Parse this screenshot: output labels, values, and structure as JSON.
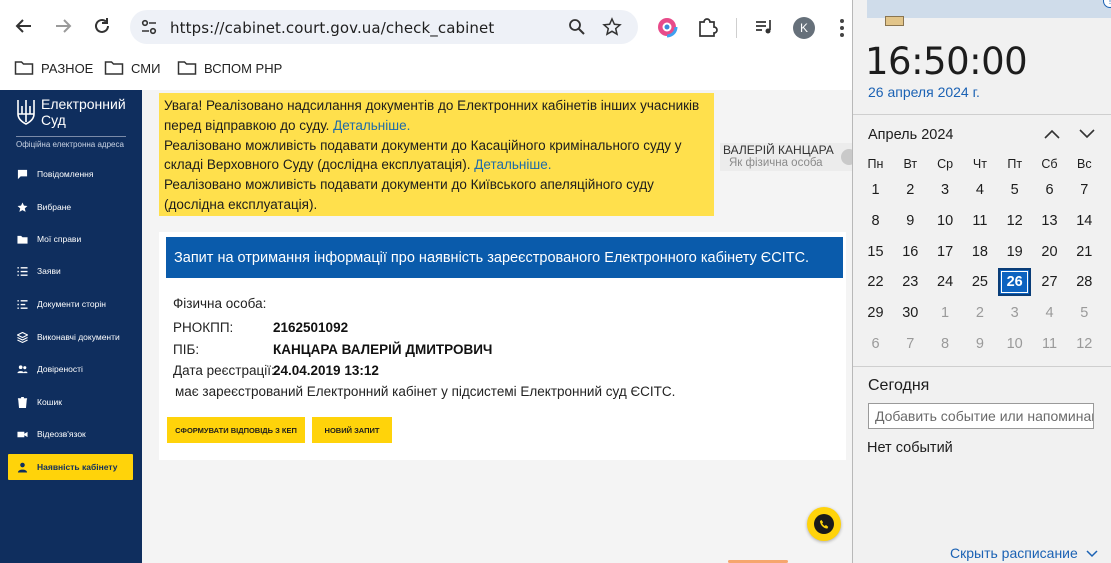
{
  "browser": {
    "url": "https://cabinet.court.gov.ua/check_cabinet",
    "avatar_letter": "K",
    "bookmarks": [
      "РАЗНОЕ",
      "СМИ",
      "ВСПОМ PHP"
    ]
  },
  "site": {
    "logo_line1": "Електронний",
    "logo_line2": "Суд",
    "logo_sub": "Офіційна електронна адреса",
    "accent_color": "#ffd30a",
    "brand_color": "#0f2e5e"
  },
  "sidebar": {
    "items": [
      {
        "label": "Повідомлення",
        "icon": "message-icon",
        "active": false
      },
      {
        "label": "Вибране",
        "icon": "star-icon",
        "active": false
      },
      {
        "label": "Мої справи",
        "icon": "folder-icon",
        "active": false
      },
      {
        "label": "Заяви",
        "icon": "list-icon",
        "active": false
      },
      {
        "label": "Документи сторін",
        "icon": "list-numbered-icon",
        "active": false
      },
      {
        "label": "Виконавчі документи",
        "icon": "layers-icon",
        "active": false
      },
      {
        "label": "Довіреності",
        "icon": "users-icon",
        "active": false
      },
      {
        "label": "Кошик",
        "icon": "trash-icon",
        "active": false
      },
      {
        "label": "Відеозв'язок",
        "icon": "video-icon",
        "active": false
      },
      {
        "label": "Наявність кабінету",
        "icon": "person-icon",
        "active": true
      }
    ]
  },
  "notice": {
    "p1": "Увага! Реалізовано надсилання документів до Електронних кабінетів інших учасників перед відправкою до суду.",
    "p1_link": "Детальніше.",
    "p2": "Реалізовано можливість подавати документи до Касаційного кримінального суду у складі Верховного Суду (дослідна експлуатація).",
    "p2_link": "Детальніше.",
    "p3": "Реалізовано можливість подавати документи до Київського апеляційного суду (дослідна експлуатація)."
  },
  "user": {
    "name": "ВАЛЕРІЙ КАНЦАРА",
    "role": "Як фізична особа"
  },
  "card": {
    "title": "Запит на отримання інформації про наявність зареєстрованого Електронного кабінету ЄСІТС.",
    "person_type": "Фізична особа:",
    "rnokpp_label": "РНОКПП:",
    "rnokpp": "2162501092",
    "pib_label": "ПІБ:",
    "pib": "КАНЦАРА ВАЛЕРІЙ ДМИТРОВИЧ",
    "reg_label": "Дата реєстрації:",
    "reg_date": "24.04.2019 13:12",
    "note": "має зареєстрований Електронний кабінет у підсистемі Електронний суд ЄСІТС.",
    "btn_form": "СФОРМУВАТИ ВІДПОВІДЬ З КЕП",
    "btn_new": "НОВИЙ ЗАПИТ"
  },
  "calendar": {
    "time": "16:50:00",
    "date": "26 апреля 2024 г.",
    "month": "Апрель 2024",
    "weekdays": [
      "Пн",
      "Вт",
      "Ср",
      "Чт",
      "Пт",
      "Сб",
      "Вс"
    ],
    "weeks": [
      [
        {
          "d": "1"
        },
        {
          "d": "2"
        },
        {
          "d": "3"
        },
        {
          "d": "4"
        },
        {
          "d": "5"
        },
        {
          "d": "6"
        },
        {
          "d": "7"
        }
      ],
      [
        {
          "d": "8"
        },
        {
          "d": "9"
        },
        {
          "d": "10"
        },
        {
          "d": "11"
        },
        {
          "d": "12"
        },
        {
          "d": "13"
        },
        {
          "d": "14"
        }
      ],
      [
        {
          "d": "15"
        },
        {
          "d": "16"
        },
        {
          "d": "17"
        },
        {
          "d": "18"
        },
        {
          "d": "19"
        },
        {
          "d": "20"
        },
        {
          "d": "21"
        }
      ],
      [
        {
          "d": "22"
        },
        {
          "d": "23"
        },
        {
          "d": "24"
        },
        {
          "d": "25"
        },
        {
          "d": "26",
          "today": true
        },
        {
          "d": "27"
        },
        {
          "d": "28"
        }
      ],
      [
        {
          "d": "29"
        },
        {
          "d": "30"
        },
        {
          "d": "1",
          "dim": true
        },
        {
          "d": "2",
          "dim": true
        },
        {
          "d": "3",
          "dim": true
        },
        {
          "d": "4",
          "dim": true
        },
        {
          "d": "5",
          "dim": true
        }
      ],
      [
        {
          "d": "6",
          "dim": true
        },
        {
          "d": "7",
          "dim": true
        },
        {
          "d": "8",
          "dim": true
        },
        {
          "d": "9",
          "dim": true
        },
        {
          "d": "10",
          "dim": true
        },
        {
          "d": "11",
          "dim": true
        },
        {
          "d": "12",
          "dim": true
        }
      ]
    ],
    "today_label": "Сегодня",
    "event_placeholder": "Добавить событие или напоминание",
    "no_events": "Нет событий",
    "hide_schedule": "Скрыть расписание"
  }
}
